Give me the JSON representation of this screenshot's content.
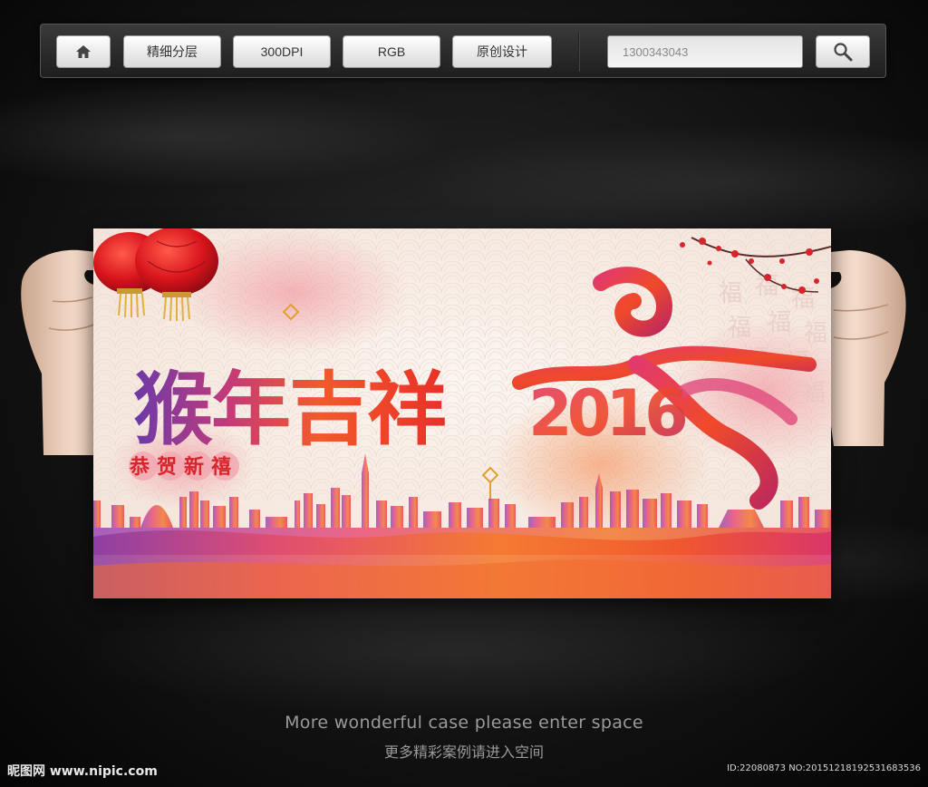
{
  "toolbar": {
    "home_icon": "home-icon",
    "buttons": [
      "精细分层",
      "300DPI",
      "RGB",
      "原创设计"
    ],
    "search_value": "1300343043",
    "search_icon": "magnifier-icon"
  },
  "poster": {
    "title": "猴年吉祥",
    "subtitle": "恭贺新禧",
    "year": "2016",
    "fu_char": "福",
    "colors": {
      "lantern": "#d8141c",
      "accent_purple": "#7a3aa8",
      "accent_orange": "#f06a1a",
      "accent_red": "#e0202a"
    }
  },
  "caption": {
    "en": "More wonderful case please enter space",
    "cn": "更多精彩案例请进入空间"
  },
  "watermark": {
    "logo": "昵图网 www.nipic.com",
    "id": "ID:22080873 NO:20151218192531683536"
  }
}
